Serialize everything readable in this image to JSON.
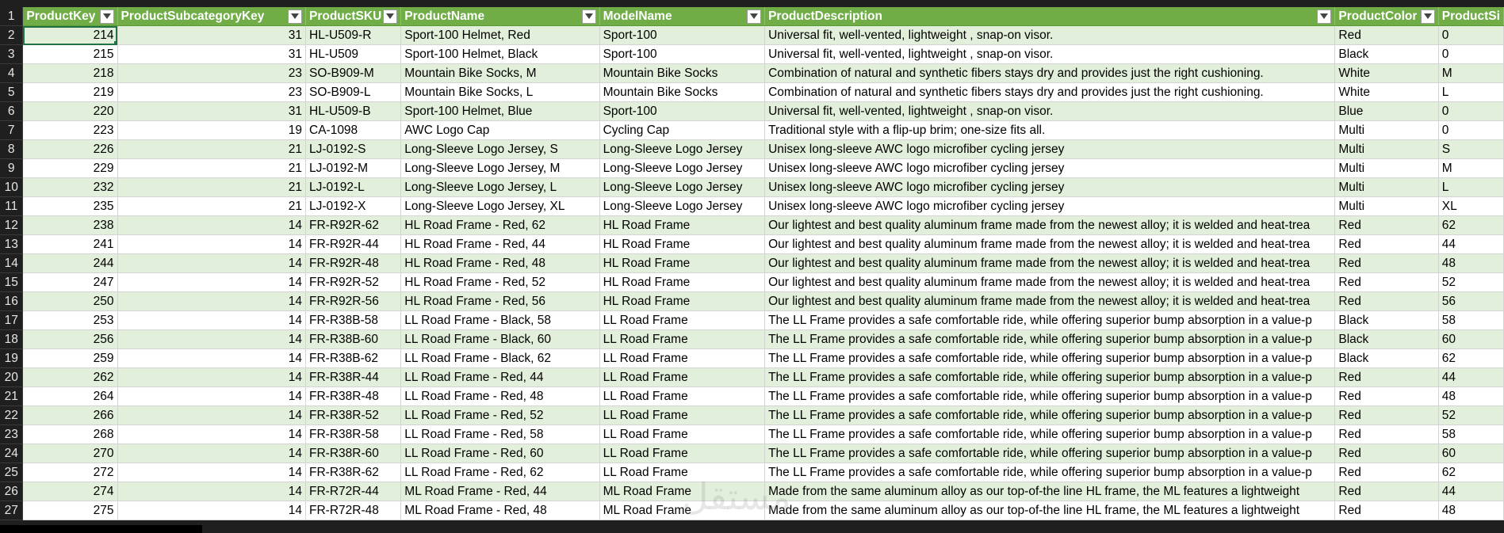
{
  "header": {
    "columns": [
      "ProductKey",
      "ProductSubcategoryKey",
      "ProductSKU",
      "ProductName",
      "ModelName",
      "ProductDescription",
      "ProductColor",
      "ProductSi"
    ],
    "row_number": "1"
  },
  "rows": [
    {
      "n": "2",
      "key": "214",
      "sub": "31",
      "sku": "HL-U509-R",
      "name": "Sport-100 Helmet, Red",
      "model": "Sport-100",
      "desc": "Universal fit, well-vented, lightweight , snap-on visor.",
      "color": "Red",
      "size": "0"
    },
    {
      "n": "3",
      "key": "215",
      "sub": "31",
      "sku": "HL-U509",
      "name": "Sport-100 Helmet, Black",
      "model": "Sport-100",
      "desc": "Universal fit, well-vented, lightweight , snap-on visor.",
      "color": "Black",
      "size": "0"
    },
    {
      "n": "4",
      "key": "218",
      "sub": "23",
      "sku": "SO-B909-M",
      "name": "Mountain Bike Socks, M",
      "model": "Mountain Bike Socks",
      "desc": "Combination of natural and synthetic fibers stays dry and provides just the right cushioning.",
      "color": "White",
      "size": "M"
    },
    {
      "n": "5",
      "key": "219",
      "sub": "23",
      "sku": "SO-B909-L",
      "name": "Mountain Bike Socks, L",
      "model": "Mountain Bike Socks",
      "desc": "Combination of natural and synthetic fibers stays dry and provides just the right cushioning.",
      "color": "White",
      "size": "L"
    },
    {
      "n": "6",
      "key": "220",
      "sub": "31",
      "sku": "HL-U509-B",
      "name": "Sport-100 Helmet, Blue",
      "model": "Sport-100",
      "desc": "Universal fit, well-vented, lightweight , snap-on visor.",
      "color": "Blue",
      "size": "0"
    },
    {
      "n": "7",
      "key": "223",
      "sub": "19",
      "sku": "CA-1098",
      "name": "AWC Logo Cap",
      "model": "Cycling Cap",
      "desc": "Traditional style with a flip-up brim; one-size fits all.",
      "color": "Multi",
      "size": "0"
    },
    {
      "n": "8",
      "key": "226",
      "sub": "21",
      "sku": "LJ-0192-S",
      "name": "Long-Sleeve Logo Jersey, S",
      "model": "Long-Sleeve Logo Jersey",
      "desc": "Unisex long-sleeve AWC logo microfiber cycling jersey",
      "color": "Multi",
      "size": "S"
    },
    {
      "n": "9",
      "key": "229",
      "sub": "21",
      "sku": "LJ-0192-M",
      "name": "Long-Sleeve Logo Jersey, M",
      "model": "Long-Sleeve Logo Jersey",
      "desc": "Unisex long-sleeve AWC logo microfiber cycling jersey",
      "color": "Multi",
      "size": "M"
    },
    {
      "n": "10",
      "key": "232",
      "sub": "21",
      "sku": "LJ-0192-L",
      "name": "Long-Sleeve Logo Jersey, L",
      "model": "Long-Sleeve Logo Jersey",
      "desc": "Unisex long-sleeve AWC logo microfiber cycling jersey",
      "color": "Multi",
      "size": "L"
    },
    {
      "n": "11",
      "key": "235",
      "sub": "21",
      "sku": "LJ-0192-X",
      "name": "Long-Sleeve Logo Jersey, XL",
      "model": "Long-Sleeve Logo Jersey",
      "desc": "Unisex long-sleeve AWC logo microfiber cycling jersey",
      "color": "Multi",
      "size": "XL"
    },
    {
      "n": "12",
      "key": "238",
      "sub": "14",
      "sku": "FR-R92R-62",
      "name": "HL Road Frame - Red, 62",
      "model": "HL Road Frame",
      "desc": "Our lightest and best quality aluminum frame made from the newest alloy; it is welded and heat-trea",
      "color": "Red",
      "size": "62"
    },
    {
      "n": "13",
      "key": "241",
      "sub": "14",
      "sku": "FR-R92R-44",
      "name": "HL Road Frame - Red, 44",
      "model": "HL Road Frame",
      "desc": "Our lightest and best quality aluminum frame made from the newest alloy; it is welded and heat-trea",
      "color": "Red",
      "size": "44"
    },
    {
      "n": "14",
      "key": "244",
      "sub": "14",
      "sku": "FR-R92R-48",
      "name": "HL Road Frame - Red, 48",
      "model": "HL Road Frame",
      "desc": "Our lightest and best quality aluminum frame made from the newest alloy; it is welded and heat-trea",
      "color": "Red",
      "size": "48"
    },
    {
      "n": "15",
      "key": "247",
      "sub": "14",
      "sku": "FR-R92R-52",
      "name": "HL Road Frame - Red, 52",
      "model": "HL Road Frame",
      "desc": "Our lightest and best quality aluminum frame made from the newest alloy; it is welded and heat-trea",
      "color": "Red",
      "size": "52"
    },
    {
      "n": "16",
      "key": "250",
      "sub": "14",
      "sku": "FR-R92R-56",
      "name": "HL Road Frame - Red, 56",
      "model": "HL Road Frame",
      "desc": "Our lightest and best quality aluminum frame made from the newest alloy; it is welded and heat-trea",
      "color": "Red",
      "size": "56"
    },
    {
      "n": "17",
      "key": "253",
      "sub": "14",
      "sku": "FR-R38B-58",
      "name": "LL Road Frame - Black, 58",
      "model": "LL Road Frame",
      "desc": "The LL Frame provides a safe comfortable ride, while offering superior bump absorption in a value-p",
      "color": "Black",
      "size": "58"
    },
    {
      "n": "18",
      "key": "256",
      "sub": "14",
      "sku": "FR-R38B-60",
      "name": "LL Road Frame - Black, 60",
      "model": "LL Road Frame",
      "desc": "The LL Frame provides a safe comfortable ride, while offering superior bump absorption in a value-p",
      "color": "Black",
      "size": "60"
    },
    {
      "n": "19",
      "key": "259",
      "sub": "14",
      "sku": "FR-R38B-62",
      "name": "LL Road Frame - Black, 62",
      "model": "LL Road Frame",
      "desc": "The LL Frame provides a safe comfortable ride, while offering superior bump absorption in a value-p",
      "color": "Black",
      "size": "62"
    },
    {
      "n": "20",
      "key": "262",
      "sub": "14",
      "sku": "FR-R38R-44",
      "name": "LL Road Frame - Red, 44",
      "model": "LL Road Frame",
      "desc": "The LL Frame provides a safe comfortable ride, while offering superior bump absorption in a value-p",
      "color": "Red",
      "size": "44"
    },
    {
      "n": "21",
      "key": "264",
      "sub": "14",
      "sku": "FR-R38R-48",
      "name": "LL Road Frame - Red, 48",
      "model": "LL Road Frame",
      "desc": "The LL Frame provides a safe comfortable ride, while offering superior bump absorption in a value-p",
      "color": "Red",
      "size": "48"
    },
    {
      "n": "22",
      "key": "266",
      "sub": "14",
      "sku": "FR-R38R-52",
      "name": "LL Road Frame - Red, 52",
      "model": "LL Road Frame",
      "desc": "The LL Frame provides a safe comfortable ride, while offering superior bump absorption in a value-p",
      "color": "Red",
      "size": "52"
    },
    {
      "n": "23",
      "key": "268",
      "sub": "14",
      "sku": "FR-R38R-58",
      "name": "LL Road Frame - Red, 58",
      "model": "LL Road Frame",
      "desc": "The LL Frame provides a safe comfortable ride, while offering superior bump absorption in a value-p",
      "color": "Red",
      "size": "58"
    },
    {
      "n": "24",
      "key": "270",
      "sub": "14",
      "sku": "FR-R38R-60",
      "name": "LL Road Frame - Red, 60",
      "model": "LL Road Frame",
      "desc": "The LL Frame provides a safe comfortable ride, while offering superior bump absorption in a value-p",
      "color": "Red",
      "size": "60"
    },
    {
      "n": "25",
      "key": "272",
      "sub": "14",
      "sku": "FR-R38R-62",
      "name": "LL Road Frame - Red, 62",
      "model": "LL Road Frame",
      "desc": "The LL Frame provides a safe comfortable ride, while offering superior bump absorption in a value-p",
      "color": "Red",
      "size": "62"
    },
    {
      "n": "26",
      "key": "274",
      "sub": "14",
      "sku": "FR-R72R-44",
      "name": "ML Road Frame - Red, 44",
      "model": "ML Road Frame",
      "desc": "Made from the same aluminum alloy as our top-of-the line HL frame, the ML features a lightweight",
      "color": "Red",
      "size": "44"
    },
    {
      "n": "27",
      "key": "275",
      "sub": "14",
      "sku": "FR-R72R-48",
      "name": "ML Road Frame - Red, 48",
      "model": "ML Road Frame",
      "desc": "Made from the same aluminum alloy as our top-of-the line HL frame, the ML features a lightweight",
      "color": "Red",
      "size": "48"
    }
  ],
  "watermark": "مستقل",
  "colors": {
    "header_green": "#70ad47",
    "band_green": "#e2efda",
    "row_header_bg": "#1f1f1f",
    "selection": "#217346"
  }
}
